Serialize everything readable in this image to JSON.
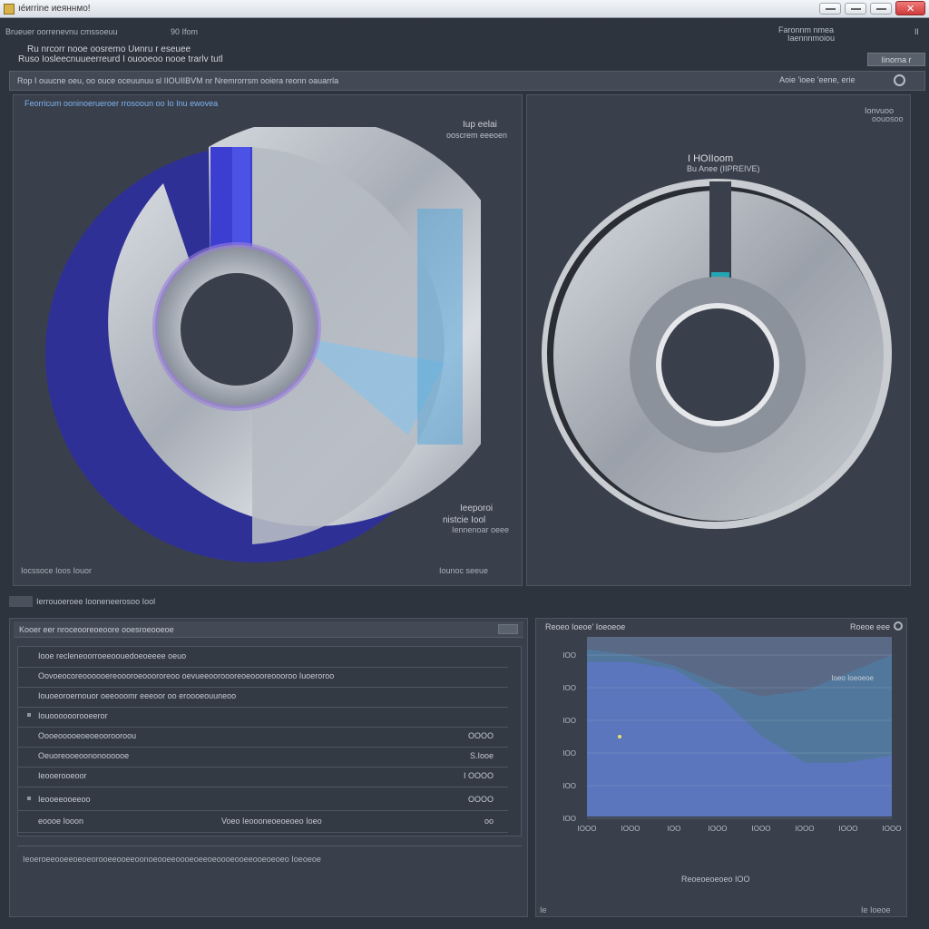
{
  "window": {
    "title": "ıе́иrrine иеяннмо!"
  },
  "topbar": {
    "menu": "Bruеuer oоrrenevnu cmssoeuu",
    "menu_extra": "90 Ifom",
    "right_a": "Faronnm nmea",
    "right_b": "Iaennnmoiou",
    "right_c": "Il",
    "info_line1": "Ru nrcorr nooe oosremo Uиnru r eseuee",
    "info_line2": "Ruso Iosleecnuueerreurd I ouooeoo nooe trarlv tutl",
    "action_button": "Iinorna r"
  },
  "toolbar": {
    "text": "Rop I ouucne oeu, oo ouce oceuunuu sl IIOUIIBVM nr Nremrorrsm ooiera reonn oauarrla",
    "right": "Aoie 'ioee 'eene, erie"
  },
  "left_panel": {
    "link": "Feоrricum ooninoerueroer rrosooun oo Io Inu ewovea",
    "label_a": "Iup eelai",
    "label_b": "ooscrem eeeoen",
    "foot_a": "Ieeporoi",
    "foot_b": "nistcie Iool",
    "foot_c": "Iennenoar oeee",
    "bottom_left": "Iocssoce Ioos Iouor",
    "bottom_right": "Iounoc seeue"
  },
  "right_panel": {
    "top_a": "Ionvuoo",
    "top_b": "oouosoo",
    "title1": "I HOIIoom",
    "title2": "Bu Anee (IIPREIVE)"
  },
  "section2": {
    "label": "Ierrouoeroee Iooneneerosoo Iool"
  },
  "table_panel": {
    "title": "Kooer eer nroceooreoeoore ooesroeooeoe",
    "rows": [
      {
        "left": "Iooe recleneoorroeeoouedoeoeeee oeuo",
        "mid": "",
        "right": ""
      },
      {
        "left": "Oovoeocoreoooooereoooroeooororeoo oevueeooroooreoeoooreoooroo Iuoeroroo",
        "mid": "",
        "right": ""
      },
      {
        "left": "Iouoeoroernouor oeeooomr eeeoor oo eroooeouuneoo",
        "mid": "",
        "right": ""
      },
      {
        "left": "Iouoooooorooeeror",
        "mid": "",
        "right": ""
      },
      {
        "left": "Oooeooooeoeoeoorooroou",
        "mid": "",
        "right": "OOOO"
      },
      {
        "left": "Oeuoreooeoononoooooe",
        "mid": "",
        "right": "S.Iooe"
      },
      {
        "left": "Ieooerooeoor",
        "mid": "",
        "right": "I OOOO"
      },
      {
        "left": "Ieooeeooeeoo",
        "mid": "",
        "right": "OOOO"
      },
      {
        "left": "eoooe Iooon",
        "mid": "Voeo Ieoooneoeoeoeo Ioeo",
        "right": "oo"
      }
    ],
    "footer": "Ieoeroeeooeeoeoeorooeeooeeoonoeooeeoooeoeeoeoooeooeeooeoeoeo Ioeoeoe"
  },
  "chart_panel": {
    "title": "Reoeo Ioeoe' Ioeoeoe",
    "right": "Roeoe eee",
    "xlabel": "Reoeoeoeoeo IOO",
    "foot_left": "Ie",
    "foot_right": "Ie Ioeoe"
  },
  "chart_data": {
    "type": "area",
    "title": "",
    "xlabel": "",
    "ylabel": "",
    "x_ticks": [
      "IOOO",
      "IOOO",
      "IOO",
      "IOOO",
      "IOOO",
      "IOOO",
      "IOOO",
      "IOOO"
    ],
    "y_ticks": [
      "IOO",
      "IOO",
      "IOO",
      "IOO",
      "IOO",
      "IOO"
    ],
    "x": [
      0,
      1,
      2,
      3,
      4,
      5,
      6,
      7
    ],
    "series": [
      {
        "values": [
          0.86,
          0.86,
          0.82,
          0.68,
          0.45,
          0.3,
          0.3,
          0.34
        ],
        "color": "#6f68c9"
      },
      {
        "values": [
          0.93,
          0.9,
          0.84,
          0.74,
          0.67,
          0.7,
          0.8,
          0.9
        ],
        "color": "#4a88b8"
      }
    ],
    "ylim": [
      0,
      1
    ],
    "legend_text": "Ioeo Ioeoeoe"
  },
  "colors": {
    "background": "#2e343e",
    "panel": "#3a404b",
    "accent_blue": "#3b3ed0",
    "accent_teal": "#25a4b3",
    "link": "#7db2f0"
  }
}
